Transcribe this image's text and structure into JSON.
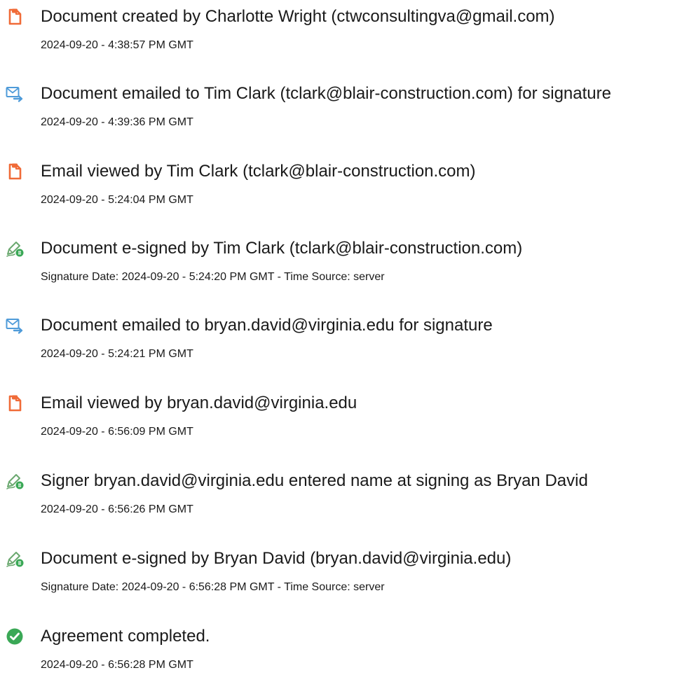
{
  "colors": {
    "document_icon": "#f06b38",
    "email_icon": "#4f9bd9",
    "esign_icon": "#6aa86f",
    "completed_icon": "#3aa856",
    "text": "#1a1a1a"
  },
  "events": [
    {
      "icon": "document-icon",
      "title": "Document created by Charlotte Wright (ctwconsultingva@gmail.com)",
      "meta": "2024-09-20 - 4:38:57 PM GMT"
    },
    {
      "icon": "email-sent-icon",
      "title": "Document emailed to Tim Clark (tclark@blair-construction.com) for signature",
      "meta": "2024-09-20 - 4:39:36 PM GMT"
    },
    {
      "icon": "document-icon",
      "title": "Email viewed by Tim Clark (tclark@blair-construction.com)",
      "meta": "2024-09-20 - 5:24:04 PM GMT"
    },
    {
      "icon": "esign-pen-icon",
      "title": "Document e-signed by Tim Clark (tclark@blair-construction.com)",
      "meta": "Signature Date: 2024-09-20 - 5:24:20 PM GMT - Time Source: server"
    },
    {
      "icon": "email-sent-icon",
      "title": "Document emailed to bryan.david@virginia.edu for signature",
      "meta": "2024-09-20 - 5:24:21 PM GMT"
    },
    {
      "icon": "document-icon",
      "title": "Email viewed by bryan.david@virginia.edu",
      "meta": "2024-09-20 - 6:56:09 PM GMT"
    },
    {
      "icon": "esign-pen-icon",
      "title": "Signer bryan.david@virginia.edu entered name at signing as Bryan David",
      "meta": "2024-09-20 - 6:56:26 PM GMT"
    },
    {
      "icon": "esign-pen-icon",
      "title": "Document e-signed by Bryan David (bryan.david@virginia.edu)",
      "meta": "Signature Date: 2024-09-20 - 6:56:28 PM GMT - Time Source: server"
    },
    {
      "icon": "checkmark-circle-icon",
      "title": "Agreement completed.",
      "meta": "2024-09-20 - 6:56:28 PM GMT"
    }
  ]
}
